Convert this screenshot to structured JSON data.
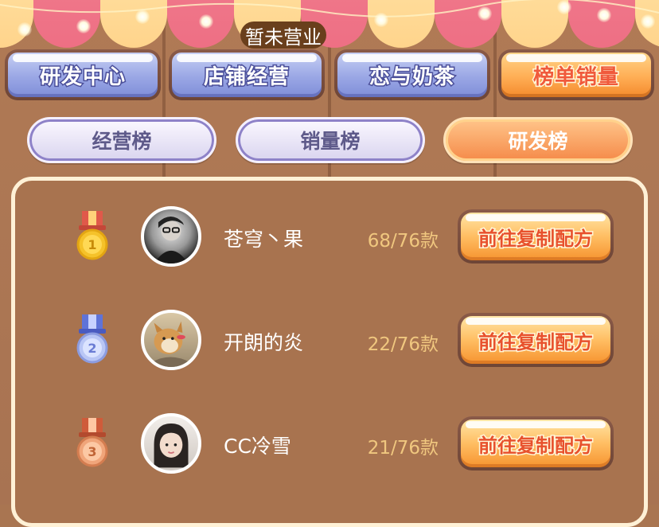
{
  "status_badge": "暂未营业",
  "categories": [
    {
      "label": "研发中心",
      "active": false
    },
    {
      "label": "店铺经营",
      "active": false
    },
    {
      "label": "恋与奶茶",
      "active": false
    },
    {
      "label": "榜单销量",
      "active": true
    }
  ],
  "subtabs": [
    {
      "label": "经营榜",
      "active": false
    },
    {
      "label": "销量榜",
      "active": false
    },
    {
      "label": "研发榜",
      "active": true
    }
  ],
  "ranking": [
    {
      "rank": "1",
      "name": "苍穹丶果",
      "count": "68/76款",
      "button": "前往复制配方",
      "medal_color": "#f5c22a",
      "ribbon_color": "#e0594a"
    },
    {
      "rank": "2",
      "name": "开朗的炎",
      "count": "22/76款",
      "button": "前往复制配方",
      "medal_color": "#b9c6f5",
      "ribbon_color": "#5f73d8"
    },
    {
      "rank": "3",
      "name": "CC冷雪",
      "count": "21/76款",
      "button": "前往复制配方",
      "medal_color": "#f0a57a",
      "ribbon_color": "#cf5b3a"
    }
  ]
}
